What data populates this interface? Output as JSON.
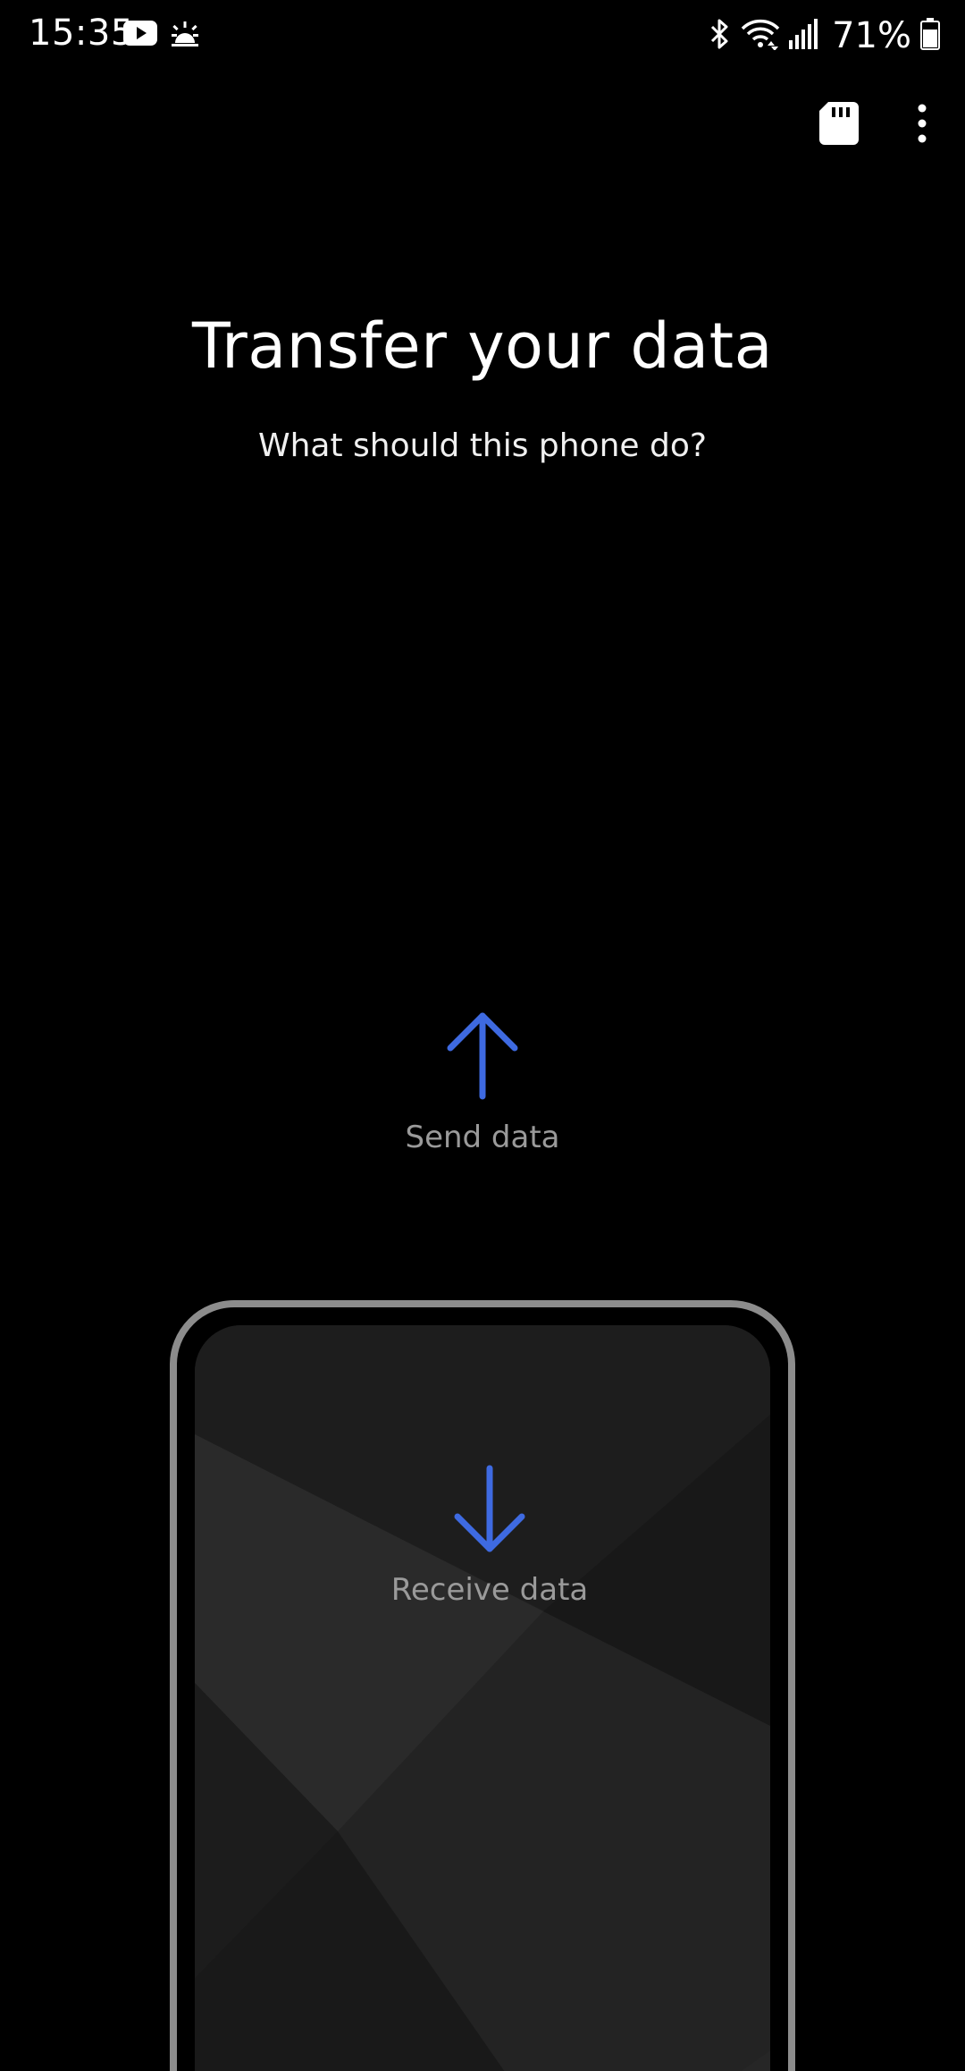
{
  "status_bar": {
    "time": "15:35",
    "battery_percent": "71%",
    "left_icons": [
      "youtube-icon",
      "weather-sunrise-icon"
    ],
    "right_icons": [
      "bluetooth-icon",
      "wifi-icon",
      "signal-icon",
      "battery-icon"
    ]
  },
  "app_bar": {
    "actions": [
      "sd-card-icon",
      "more-options-icon"
    ]
  },
  "header": {
    "title": "Transfer your data",
    "subtitle": "What should this phone do?"
  },
  "options": {
    "send": {
      "label": "Send data",
      "icon": "arrow-up-icon"
    },
    "receive": {
      "label": "Receive data",
      "icon": "arrow-down-icon"
    }
  },
  "colors": {
    "background": "#000000",
    "accent": "#3e6ae1",
    "label_gray": "#9a9a9a",
    "phone_frame": "#8c8c8c"
  }
}
